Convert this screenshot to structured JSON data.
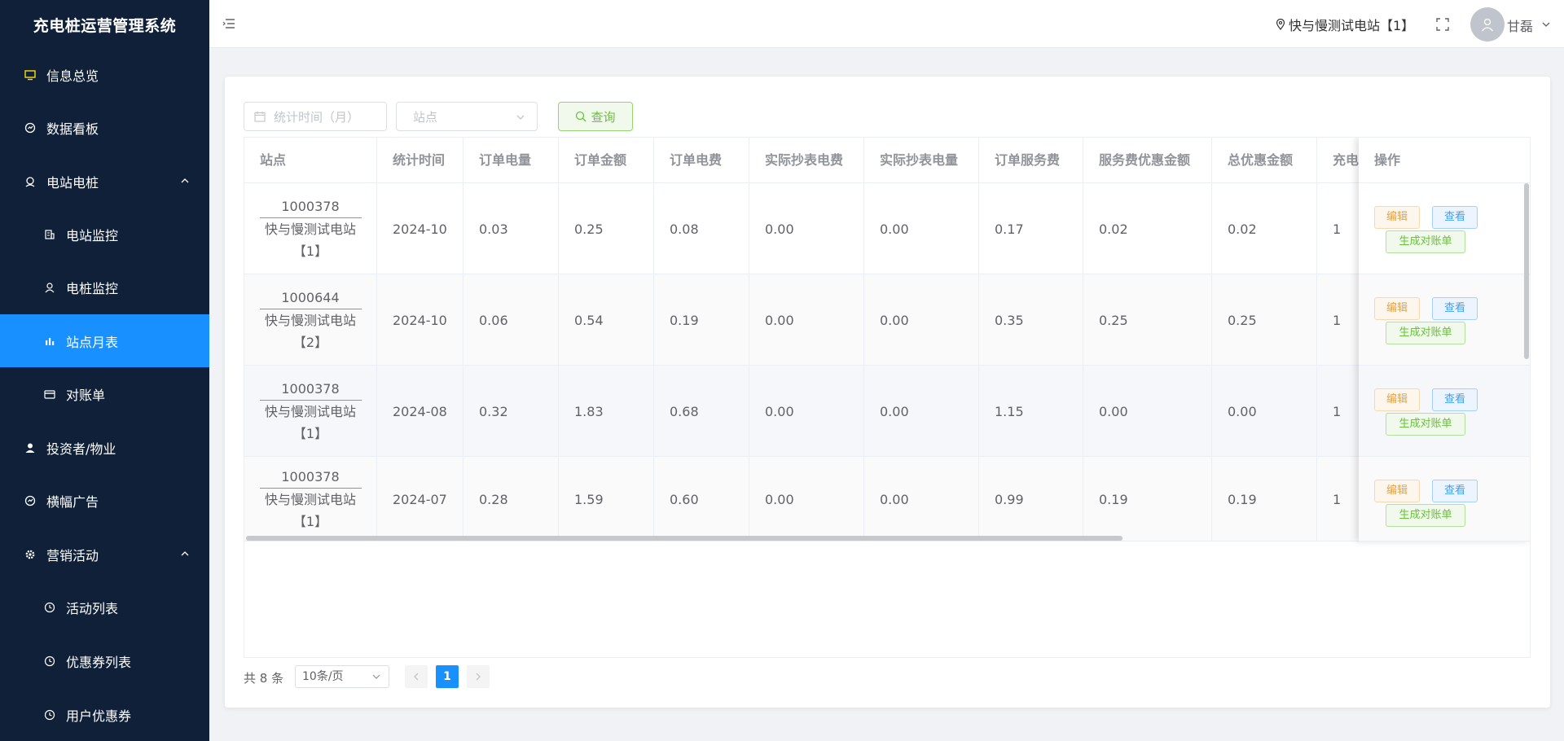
{
  "app": {
    "title": "充电桩运营管理系统"
  },
  "sidebar": {
    "items": [
      {
        "label": "信息总览",
        "icon": "monitor-icon"
      },
      {
        "label": "数据看板",
        "icon": "dashboard-icon"
      },
      {
        "label": "电站电桩",
        "icon": "station-icon",
        "expanded": true
      },
      {
        "label": "电站监控",
        "icon": "building-icon"
      },
      {
        "label": "电桩监控",
        "icon": "user-icon"
      },
      {
        "label": "站点月表",
        "icon": "bar-chart-icon",
        "active": true
      },
      {
        "label": "对账单",
        "icon": "card-icon"
      },
      {
        "label": "投资者/物业",
        "icon": "person-icon"
      },
      {
        "label": "横幅广告",
        "icon": "dashboard-icon"
      },
      {
        "label": "营销活动",
        "icon": "gear-icon",
        "expanded": true
      },
      {
        "label": "活动列表",
        "icon": "clock-icon"
      },
      {
        "label": "优惠券列表",
        "icon": "clock-icon"
      },
      {
        "label": "用户优惠券",
        "icon": "clock-icon"
      }
    ]
  },
  "header": {
    "station": "快与慢测试电站【1】",
    "user": "甘磊"
  },
  "filters": {
    "date_placeholder": "统计时间（月）",
    "station_placeholder": "站点",
    "query_label": "查询"
  },
  "table": {
    "columns": [
      "站点",
      "统计时间",
      "订单电量",
      "订单金额",
      "订单电费",
      "实际抄表电费",
      "实际抄表电量",
      "订单服务费",
      "服务费优惠金额",
      "总优惠金额",
      "充电次数",
      "操作"
    ],
    "rows": [
      {
        "station_id": "1000378",
        "station_name": "快与慢测试电站",
        "station_suffix": "【1】",
        "month": "2024-10",
        "energy": "0.03",
        "amount": "0.25",
        "elec_fee": "0.08",
        "meter_fee": "0.00",
        "meter_energy": "0.00",
        "service_fee": "0.17",
        "service_discount": "0.02",
        "total_discount": "0.02",
        "count": "1"
      },
      {
        "station_id": "1000644",
        "station_name": "快与慢测试电站",
        "station_suffix": "【2】",
        "month": "2024-10",
        "energy": "0.06",
        "amount": "0.54",
        "elec_fee": "0.19",
        "meter_fee": "0.00",
        "meter_energy": "0.00",
        "service_fee": "0.35",
        "service_discount": "0.25",
        "total_discount": "0.25",
        "count": "1"
      },
      {
        "station_id": "1000378",
        "station_name": "快与慢测试电站",
        "station_suffix": "【1】",
        "month": "2024-08",
        "energy": "0.32",
        "amount": "1.83",
        "elec_fee": "0.68",
        "meter_fee": "0.00",
        "meter_energy": "0.00",
        "service_fee": "1.15",
        "service_discount": "0.00",
        "total_discount": "0.00",
        "count": "1"
      },
      {
        "station_id": "1000378",
        "station_name": "快与慢测试电站",
        "station_suffix": "【1】",
        "month": "2024-07",
        "energy": "0.28",
        "amount": "1.59",
        "elec_fee": "0.60",
        "meter_fee": "0.00",
        "meter_energy": "0.00",
        "service_fee": "0.99",
        "service_discount": "0.19",
        "total_discount": "0.19",
        "count": "1"
      }
    ],
    "actions": {
      "edit": "编辑",
      "view": "查看",
      "bill": "生成对账单"
    }
  },
  "pagination": {
    "total": "共 8 条",
    "page_size": "10条/页",
    "current_page": "1"
  }
}
